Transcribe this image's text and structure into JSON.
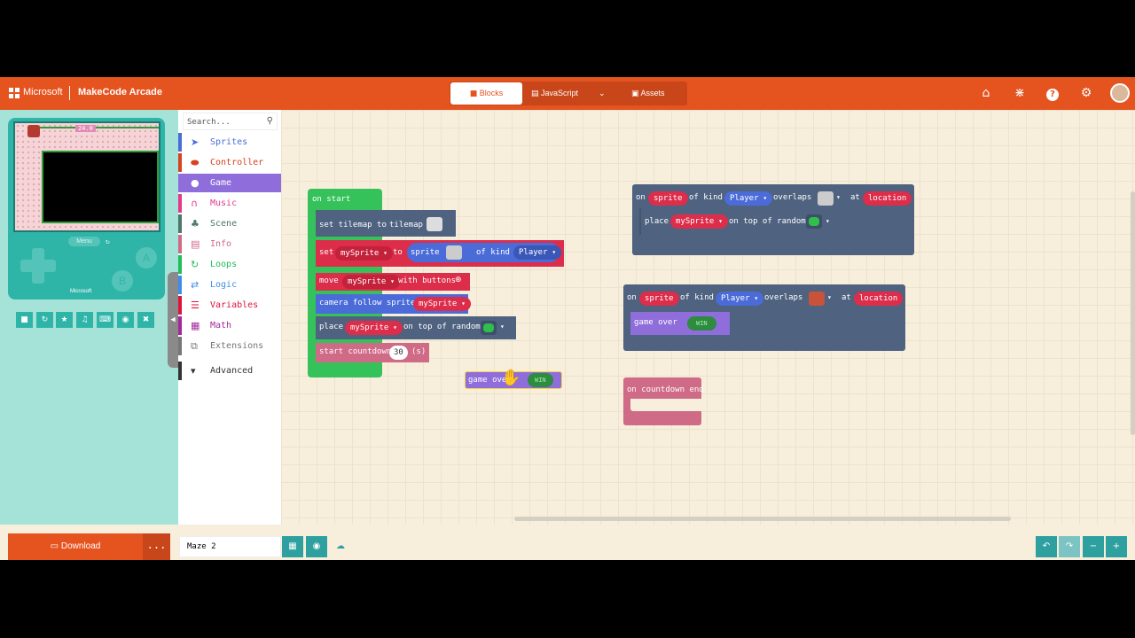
{
  "header": {
    "ms_label": "Microsoft",
    "app_title": "MakeCode Arcade",
    "tabs": [
      {
        "label": "Blocks",
        "icon": "puzzle-icon"
      },
      {
        "label": "JavaScript",
        "icon": "code-icon"
      },
      {
        "label": "Assets",
        "icon": "assets-icon"
      }
    ],
    "icons": [
      "home-icon",
      "share-icon",
      "help-icon",
      "settings-icon",
      "avatar"
    ]
  },
  "simulator": {
    "timer_text": "24.0",
    "menu_label": "Menu",
    "a_label": "A",
    "b_label": "B",
    "brand": "Microsoft",
    "toolbar": [
      "stop-icon",
      "restart-icon",
      "debug-icon",
      "mute-icon",
      "keyboard-icon",
      "screenshot-icon",
      "fullscreen-icon"
    ]
  },
  "toolbox": {
    "search_placeholder": "Search...",
    "categories": [
      {
        "label": "Sprites",
        "color": "#4b6cd8",
        "icon": "paper-plane-icon"
      },
      {
        "label": "Controller",
        "color": "#d54322",
        "icon": "gamepad-icon"
      },
      {
        "label": "Game",
        "color": "#8f6ddb",
        "icon": "circle-icon",
        "selected": true
      },
      {
        "label": "Music",
        "color": "#e4388a",
        "icon": "headphones-icon"
      },
      {
        "label": "Scene",
        "color": "#4b7868",
        "icon": "tree-icon"
      },
      {
        "label": "Info",
        "color": "#cf6a87",
        "icon": "id-card-icon"
      },
      {
        "label": "Loops",
        "color": "#20bf55",
        "icon": "loop-icon"
      },
      {
        "label": "Logic",
        "color": "#3b8eea",
        "icon": "shuffle-icon"
      },
      {
        "label": "Variables",
        "color": "#dc143c",
        "icon": "list-icon"
      },
      {
        "label": "Math",
        "color": "#a5289a",
        "icon": "calculator-icon"
      },
      {
        "label": "Extensions",
        "color": "#777777",
        "icon": "plus-icon"
      }
    ],
    "advanced_label": "Advanced"
  },
  "blocks": {
    "on_start": "on start",
    "set_tilemap": "set tilemap to",
    "tilemap": "tilemap",
    "set": "set",
    "mySprite": "mySprite",
    "to": "to",
    "sprite": "sprite",
    "of_kind": "of kind",
    "player": "Player",
    "move": "move",
    "with_buttons": "with buttons",
    "camera_follow": "camera follow sprite",
    "place": "place",
    "on_top_of_random": "on top of random",
    "start_countdown": "start countdown",
    "countdown_value": "30",
    "seconds": "(s)",
    "game_over": "game over",
    "game_over_short": "game ove",
    "win": "WIN",
    "on": "on",
    "overlaps": "overlaps",
    "at": "at",
    "location": "location",
    "on_countdown_end": "on countdown end"
  },
  "bottom": {
    "download_label": "Download",
    "more_label": "...",
    "project_name": "Maze 2"
  }
}
